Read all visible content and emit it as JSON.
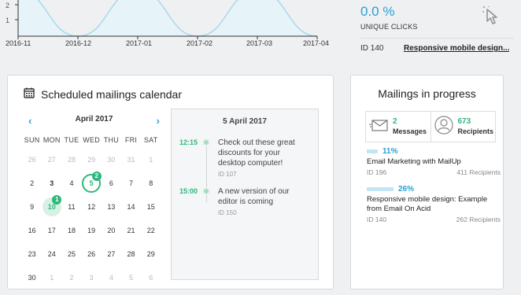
{
  "stats": {
    "unique_clicks_value": "0.0 %",
    "unique_clicks_label": "UNIQUE CLICKS",
    "row": {
      "id": "ID 140",
      "link": "Responsive mobile design..."
    },
    "icon": "cursor-click-icon"
  },
  "chart_data": {
    "type": "area",
    "x": [
      "2016-11",
      "2016-12",
      "2017-01",
      "2017-02",
      "2017-03",
      "2017-04"
    ],
    "y_ticks": [
      "2",
      "1"
    ],
    "series": [
      {
        "values": [
          2.5,
          0,
          2.5,
          0,
          2.5,
          0
        ]
      }
    ],
    "color": "#a8d8ec",
    "fill": "#e6f4fa"
  },
  "calendar": {
    "title": "Scheduled mailings calendar",
    "icon": "calendar-icon",
    "month": "April 2017",
    "prev": "‹",
    "next": "›",
    "weekdays": [
      "SUN",
      "MON",
      "TUE",
      "WED",
      "THU",
      "FRI",
      "SAT"
    ],
    "days": [
      {
        "d": "26",
        "m": true
      },
      {
        "d": "27",
        "m": true
      },
      {
        "d": "28",
        "m": true
      },
      {
        "d": "29",
        "m": true
      },
      {
        "d": "30",
        "m": true
      },
      {
        "d": "31",
        "m": true
      },
      {
        "d": "1",
        "m": true
      },
      {
        "d": "2"
      },
      {
        "d": "3",
        "bold": true
      },
      {
        "d": "4"
      },
      {
        "d": "5",
        "style": "ring",
        "badge": "2"
      },
      {
        "d": "6"
      },
      {
        "d": "7"
      },
      {
        "d": "8"
      },
      {
        "d": "9"
      },
      {
        "d": "10",
        "style": "filled",
        "badge": "1"
      },
      {
        "d": "11"
      },
      {
        "d": "12"
      },
      {
        "d": "13"
      },
      {
        "d": "14"
      },
      {
        "d": "15"
      },
      {
        "d": "16"
      },
      {
        "d": "17"
      },
      {
        "d": "18"
      },
      {
        "d": "19"
      },
      {
        "d": "20"
      },
      {
        "d": "21"
      },
      {
        "d": "22"
      },
      {
        "d": "23"
      },
      {
        "d": "24"
      },
      {
        "d": "25"
      },
      {
        "d": "26"
      },
      {
        "d": "27"
      },
      {
        "d": "28"
      },
      {
        "d": "29"
      },
      {
        "d": "30"
      },
      {
        "d": "1",
        "m": true
      },
      {
        "d": "2",
        "m": true
      },
      {
        "d": "3",
        "m": true
      },
      {
        "d": "4",
        "m": true
      },
      {
        "d": "5",
        "m": true
      },
      {
        "d": "6",
        "m": true
      }
    ],
    "detail": {
      "date": "5 April 2017",
      "events": [
        {
          "time": "12:15",
          "text": "Check out these great discounts for your desktop computer!",
          "id": "ID 107"
        },
        {
          "time": "15:00",
          "text": "A new version of our editor is coming",
          "id": "ID 150"
        }
      ]
    }
  },
  "progress": {
    "title": "Mailings in progress",
    "messages": {
      "count": "2",
      "label": "Messages",
      "icon": "envelope-icon"
    },
    "recipients": {
      "count": "673",
      "label": "Recipients",
      "icon": "user-icon"
    },
    "items": [
      {
        "pct": "11%",
        "progress": 0.11,
        "title": "Email Marketing with MailUp",
        "id": "ID 196",
        "recipients": "411 Recipients"
      },
      {
        "pct": "26%",
        "progress": 0.26,
        "title": "Responsive mobile design: Example from Email On Acid",
        "id": "ID 140",
        "recipients": "262 Recipients"
      }
    ]
  }
}
